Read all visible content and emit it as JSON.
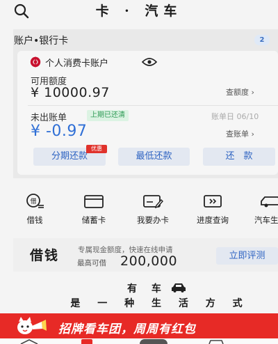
{
  "header": {
    "title": "卡 · 汽车"
  },
  "account": {
    "section_title": "账户•银行卡",
    "count": "2",
    "card_name": "个人消费卡账户",
    "available_label": "可用额度",
    "available_value": "¥ 10000.97",
    "check_limit_link": "查额度 ›",
    "bill_label": "未出账单",
    "bill_badge": "上期已还清",
    "bill_date": "账单日 06/10",
    "bill_value": "¥ -0.97",
    "check_bill_link": "查账单 ›",
    "promo_tag": "优惠",
    "buttons": {
      "installment": "分期还款",
      "min_payment": "最低还款",
      "repay": "还　款"
    }
  },
  "actions": [
    {
      "label": "借钱",
      "icon": "borrow-icon"
    },
    {
      "label": "储蓄卡",
      "icon": "debit-card-icon"
    },
    {
      "label": "我要办卡",
      "icon": "apply-card-icon"
    },
    {
      "label": "进度查询",
      "icon": "progress-icon"
    },
    {
      "label": "汽车生",
      "icon": "car-life-icon"
    }
  ],
  "loan": {
    "title": "借钱",
    "description": "专属现金额度，快速在线申请",
    "max_label": "最高可借",
    "max_value": "200,000",
    "button": "立即评测"
  },
  "slogan": {
    "line1": "有 车",
    "line2": "是 一 种 生 活 方 式"
  },
  "banner": {
    "text": "招牌看车团，周周有红包"
  },
  "colors": {
    "accent_blue": "#2f6fd6",
    "banner_red": "#e72a26",
    "badge_green": "#2e9a55",
    "bank_red": "#c8102e"
  }
}
